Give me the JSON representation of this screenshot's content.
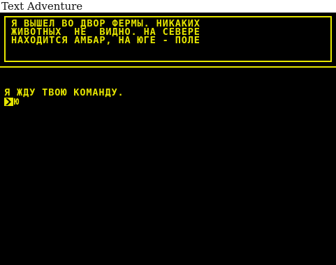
{
  "window": {
    "title": "Text Adventure"
  },
  "room": {
    "lines": [
      "Я ВЫШЕЛ ВО ДВОР ФЕРМЫ. НИКАКИХ",
      "ЖИВОТНЫХ  НЕ  ВИДНО. НА СЕВЕРЕ",
      "НАХОДИТСЯ АМБАР, НА ЮГЕ - ПОЛЕ"
    ]
  },
  "console": {
    "message": "Я ЖДУ ТВОЮ КОМАНДУ.",
    "input_value": "Ю",
    "cursor_icon": "prompt-arrow-icon"
  },
  "colors": {
    "text": "#e6e600",
    "background": "#000000"
  }
}
